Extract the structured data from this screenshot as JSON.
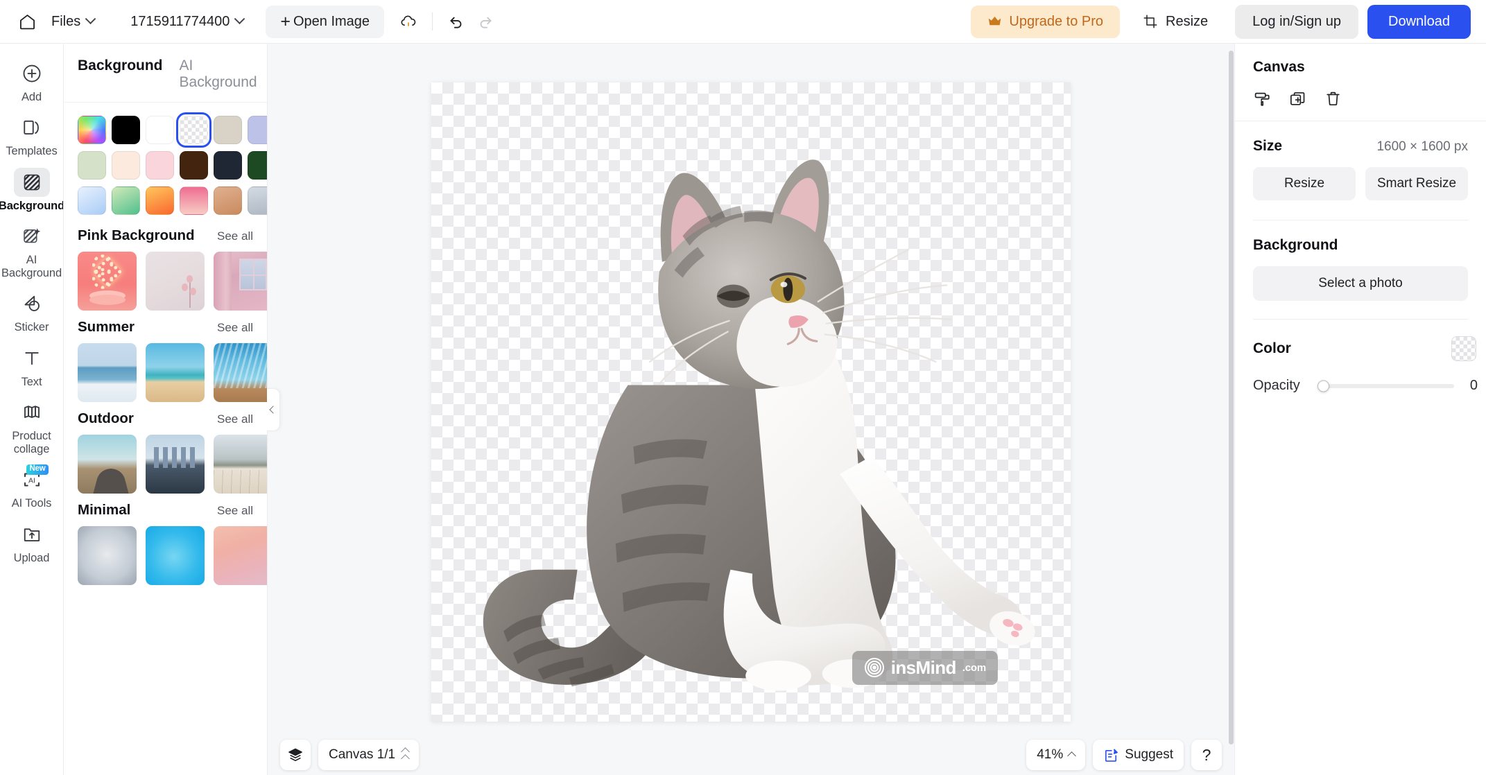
{
  "header": {
    "home_icon": "home-icon",
    "files_label": "Files",
    "project_name": "1715911774400",
    "open_image_label": "Open Image",
    "cloud_icon": "cloud-save-icon",
    "undo_icon": "undo-icon",
    "redo_icon": "redo-icon",
    "upgrade_label": "Upgrade to Pro",
    "crown_icon": "crown-icon",
    "resize_label": "Resize",
    "resize_icon": "crop-resize-icon",
    "login_label": "Log in/Sign up",
    "download_label": "Download",
    "accent_blue": "#2a50ef",
    "pro_bg": "#fdeacd",
    "pro_fg": "#c1671a"
  },
  "rail": {
    "items": [
      {
        "label": "Add",
        "icon": "plus-circle-icon",
        "active": false,
        "badge": ""
      },
      {
        "label": "Templates",
        "icon": "templates-icon",
        "active": false,
        "badge": ""
      },
      {
        "label": "Background",
        "icon": "background-hatch-icon",
        "active": true,
        "badge": ""
      },
      {
        "label": "AI\nBackground",
        "icon": "ai-background-icon",
        "active": false,
        "badge": ""
      },
      {
        "label": "Sticker",
        "icon": "sticker-icon",
        "active": false,
        "badge": ""
      },
      {
        "label": "Text",
        "icon": "text-icon",
        "active": false,
        "badge": ""
      },
      {
        "label": "Product\ncollage",
        "icon": "product-collage-icon",
        "active": false,
        "badge": ""
      },
      {
        "label": "AI Tools",
        "icon": "ai-tools-icon",
        "active": false,
        "badge": "New"
      },
      {
        "label": "Upload",
        "icon": "upload-folder-icon",
        "active": false,
        "badge": ""
      }
    ]
  },
  "panel": {
    "tabs": [
      {
        "label": "Background",
        "active": true
      },
      {
        "label": "AI Background",
        "active": false
      }
    ],
    "swatches": [
      {
        "name": "color-picker-wheel",
        "color": "rainbow",
        "selected": false
      },
      {
        "name": "black",
        "color": "#000000",
        "selected": false
      },
      {
        "name": "white",
        "color": "#ffffff",
        "selected": false
      },
      {
        "name": "transparent",
        "color": "transparent",
        "selected": true
      },
      {
        "name": "beige",
        "color": "#d8d3c6",
        "selected": false
      },
      {
        "name": "periwinkle",
        "color": "#bcc2e8",
        "selected": false
      },
      {
        "name": "mint",
        "color": "#c6ecdd",
        "selected": false
      },
      {
        "name": "sage",
        "color": "#d5e2c9",
        "selected": false
      },
      {
        "name": "cream",
        "color": "#fbeadd",
        "selected": false
      },
      {
        "name": "blush-pink",
        "color": "#fad5db",
        "selected": false
      },
      {
        "name": "dark-brown",
        "color": "#42240f",
        "selected": false
      },
      {
        "name": "midnight-navy",
        "color": "#1e2733",
        "selected": false
      },
      {
        "name": "forest-green",
        "color": "#1d4a22",
        "selected": false
      },
      {
        "name": "violet",
        "color": "#7b1ef5",
        "selected": false
      },
      {
        "name": "sky-blue-gradient",
        "color": "#cfe3fb",
        "selected": false
      },
      {
        "name": "green-gradient",
        "color": "#8ed1a6",
        "selected": false
      },
      {
        "name": "orange-gradient",
        "color": "#fba653",
        "selected": false
      },
      {
        "name": "pink-gradient",
        "color": "#f391a8",
        "selected": false
      },
      {
        "name": "tan-gradient",
        "color": "#d9a079",
        "selected": false
      },
      {
        "name": "silver-gradient",
        "color": "#c3cad4",
        "selected": false
      },
      {
        "name": "charcoal-gradient",
        "color": "#3a3a3c",
        "selected": false
      }
    ],
    "sections": [
      {
        "title": "Pink Background",
        "see_all": "See all",
        "thumbs": [
          "neon-heart-podium",
          "pink-flower-wall",
          "pink-curtain-window"
        ]
      },
      {
        "title": "Summer",
        "see_all": "See all",
        "thumbs": [
          "calm-ocean-horizon",
          "tropical-beach-sand",
          "swimming-pool-deck"
        ]
      },
      {
        "title": "Outdoor",
        "see_all": "See all",
        "thumbs": [
          "desert-road-cactus",
          "city-skyline-highway",
          "mountain-wood-floor"
        ]
      },
      {
        "title": "Minimal",
        "see_all": "See all",
        "thumbs": [
          "grey-radial-gradient",
          "blue-radial-gradient",
          "peach-pink-gradient"
        ]
      }
    ],
    "collapse_icon": "chevron-left-icon"
  },
  "canvas": {
    "watermark_text": "insMind",
    "watermark_domain": ".com",
    "watermark_icon": "spiral-logo-icon",
    "subject": "grey-white-kitten-photo"
  },
  "inspector": {
    "title": "Canvas",
    "tool_icons": [
      {
        "name": "paint-roller-icon"
      },
      {
        "name": "duplicate-icon"
      },
      {
        "name": "delete-trash-icon"
      }
    ],
    "size_label": "Size",
    "size_value": "1600 × 1600 px",
    "resize_label": "Resize",
    "smart_resize_label": "Smart Resize",
    "background_label": "Background",
    "select_photo_label": "Select a photo",
    "color_label": "Color",
    "color_value": "transparent",
    "opacity_label": "Opacity",
    "opacity_value": "0"
  },
  "bottombar": {
    "layers_icon": "layers-icon",
    "canvas_pages_label": "Canvas 1/1",
    "canvas_pages_icon": "double-chevron-up-icon",
    "zoom_label": "41%",
    "zoom_icon": "chevron-up-icon",
    "suggest_label": "Suggest",
    "suggest_icon": "suggest-edit-icon",
    "help_label": "?"
  }
}
